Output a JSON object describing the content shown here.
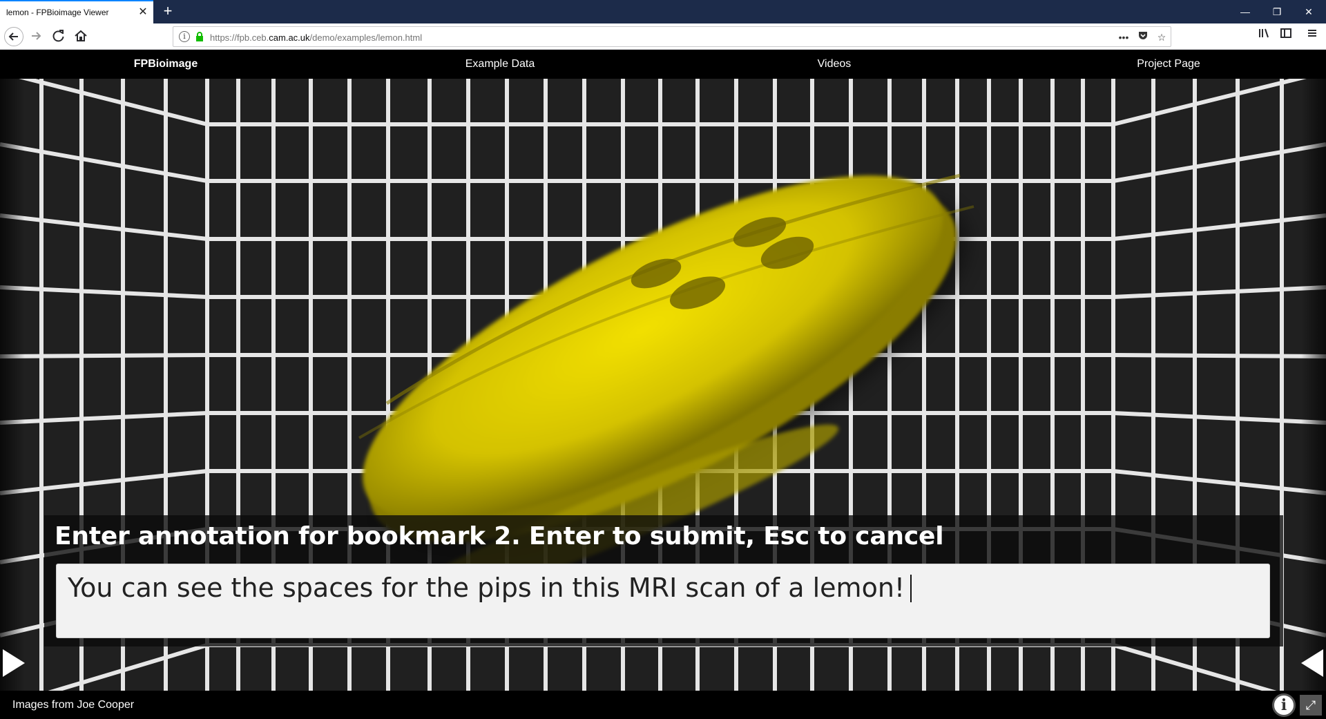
{
  "browser": {
    "tab_title": "lemon - FPBioimage Viewer",
    "tab_close_glyph": "✕",
    "new_tab_glyph": "+",
    "url_prefix": "https://fpb.ceb.",
    "url_domain": "cam.ac.uk",
    "url_path": "/demo/examples/lemon.html",
    "window_controls": {
      "minimize": "—",
      "restore": "❐",
      "close": "✕"
    },
    "icons": [
      "back-icon",
      "forward-icon",
      "reload-icon",
      "home-icon",
      "info-icon",
      "lock-icon",
      "page-actions-icon",
      "pocket-icon",
      "bookmark-star-icon",
      "library-icon",
      "sidebar-icon",
      "menu-icon"
    ]
  },
  "site_nav": {
    "items": [
      {
        "label": "FPBioimage"
      },
      {
        "label": "Example Data"
      },
      {
        "label": "Videos"
      },
      {
        "label": "Project Page"
      }
    ]
  },
  "annotation": {
    "prompt": "Enter annotation for bookmark 2. Enter to submit, Esc to cancel",
    "value": "You can see the spaces for the pips in this MRI scan of a lemon!"
  },
  "footer": {
    "credit": "Images from Joe Cooper",
    "info_glyph": "i",
    "fullscreen_glyph": "⤢"
  },
  "colors": {
    "tabbar": "#1c2b4a",
    "lemon": "#d8c800",
    "grid": "#e6e6e6",
    "viewer_bg": "#202020"
  }
}
